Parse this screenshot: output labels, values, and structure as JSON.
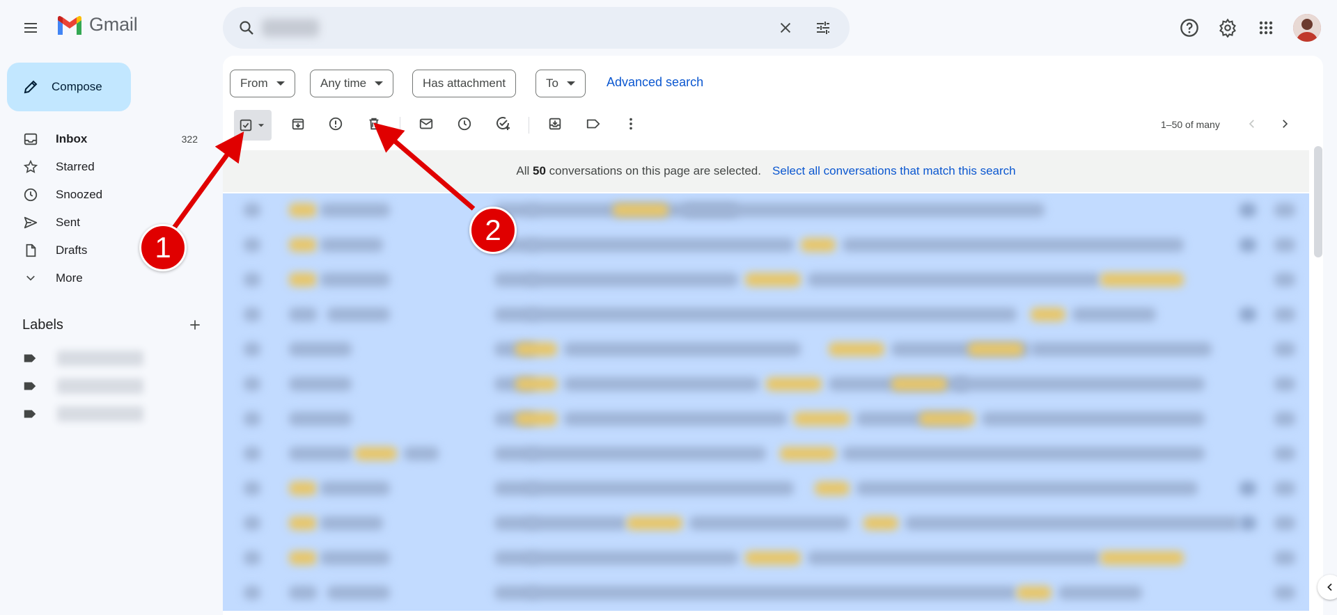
{
  "app": {
    "name": "Gmail"
  },
  "search": {
    "value": "",
    "placeholder": ""
  },
  "compose": {
    "label": "Compose"
  },
  "nav": [
    {
      "label": "Inbox",
      "count": "322",
      "icon": "inbox-icon"
    },
    {
      "label": "Starred",
      "icon": "star-icon"
    },
    {
      "label": "Snoozed",
      "icon": "clock-icon"
    },
    {
      "label": "Sent",
      "icon": "send-icon"
    },
    {
      "label": "Drafts",
      "icon": "draft-icon"
    },
    {
      "label": "More",
      "icon": "chevron-down-icon"
    }
  ],
  "labels": {
    "title": "Labels",
    "item_count": 3
  },
  "filters": {
    "from": "From",
    "any_time": "Any time",
    "has_attachment": "Has attachment",
    "to": "To",
    "advanced": "Advanced search"
  },
  "pager": {
    "text": "1–50 of many"
  },
  "banner": {
    "prefix": "All",
    "count": "50",
    "suffix": "conversations on this page are selected.",
    "link": "Select all conversations that match this search"
  },
  "annotations": {
    "badge1": "1",
    "badge2": "2"
  },
  "colors": {
    "accent": "#0b57d0",
    "compose_bg": "#c2e7ff",
    "selected_row_bg": "#c2dbff",
    "annotation_red": "#e00000"
  }
}
